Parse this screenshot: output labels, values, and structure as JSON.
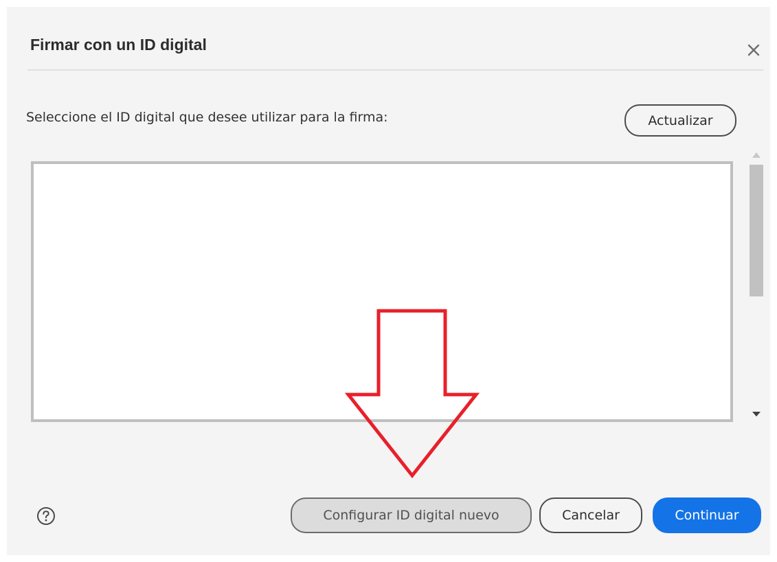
{
  "dialog": {
    "title": "Firmar con un ID digital",
    "prompt": "Seleccione el ID digital que desee utilizar para la firma:",
    "buttons": {
      "refresh": "Actualizar",
      "configure_new": "Configurar ID digital nuevo",
      "cancel": "Cancelar",
      "continue": "Continuar"
    },
    "digital_ids": []
  },
  "icons": {
    "close": "close-icon",
    "help": "help-icon",
    "annotation": "arrow-down-icon"
  },
  "colors": {
    "primary": "#1473e6",
    "annotation": "#e8202a",
    "background": "#f4f4f4"
  }
}
